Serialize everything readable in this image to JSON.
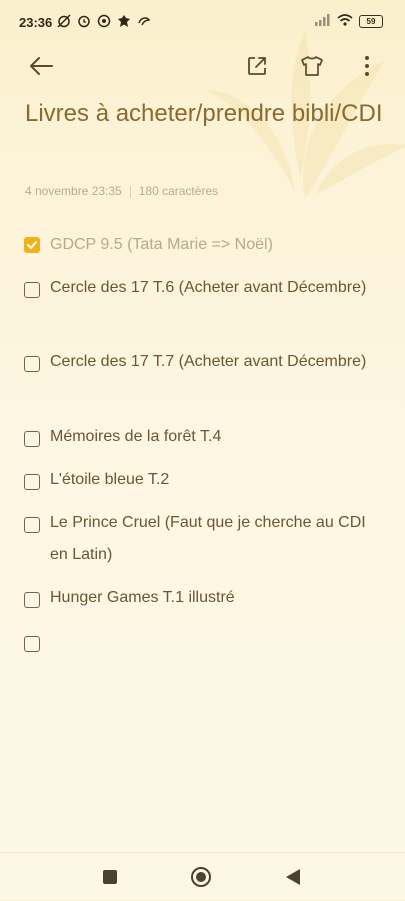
{
  "status": {
    "time": "23:36",
    "battery": "59"
  },
  "note": {
    "title": "Livres à acheter/prendre bibli/CDI",
    "date": "4 novembre 23:35",
    "char_count": "180 caractères"
  },
  "checklist": [
    {
      "text": "GDCP 9.5 (Tata Marie => Noël)",
      "checked": true
    },
    {
      "text": "Cercle des 17 T.6 (Acheter avant Décembre)",
      "checked": false
    },
    {
      "text": "Cercle des 17 T.7 (Acheter avant Décembre)",
      "checked": false
    },
    {
      "text": "Mémoires de la forêt T.4",
      "checked": false
    },
    {
      "text": "L'étoile bleue T.2",
      "checked": false
    },
    {
      "text": "Le Prince Cruel (Faut que je cherche au CDI en Latin)",
      "checked": false
    },
    {
      "text": "Hunger Games T.1 illustré",
      "checked": false
    },
    {
      "text": "",
      "checked": false
    }
  ],
  "icons": {
    "back": "arrow-left-icon",
    "share": "share-icon",
    "theme": "tshirt-icon",
    "more": "more-vertical-icon"
  },
  "colors": {
    "accent": "#f2b21b",
    "title": "#8a6a2e",
    "text": "#6b5631"
  }
}
